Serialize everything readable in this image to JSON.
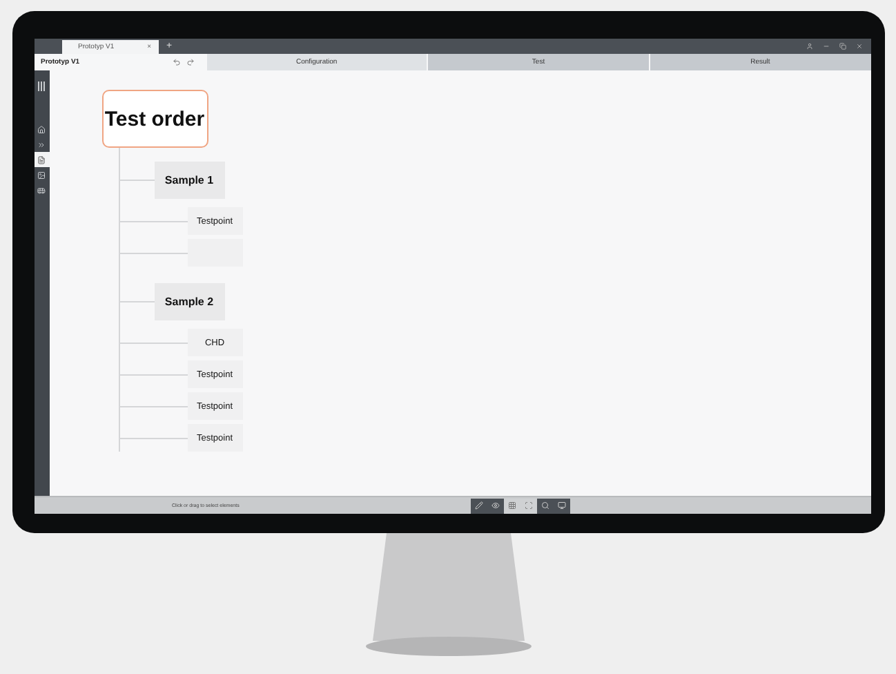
{
  "window": {
    "tab": {
      "title": "Prototyp V1",
      "close": "×"
    },
    "new_tab": "+"
  },
  "project": {
    "name": "Prototyp V1"
  },
  "tabs": [
    {
      "label": "Configuration",
      "selected": true
    },
    {
      "label": "Test",
      "selected": false
    },
    {
      "label": "Result",
      "selected": false
    }
  ],
  "sidebar": {
    "items": [
      {
        "selected": false
      },
      {
        "selected": false
      },
      {
        "selected": true
      },
      {
        "selected": false
      },
      {
        "selected": false
      }
    ]
  },
  "tree": {
    "label": "Test order",
    "children": [
      {
        "kind": "group",
        "label": "Sample 1",
        "children": [
          {
            "kind": "point",
            "label": "Testpoint"
          },
          {
            "kind": "blank"
          }
        ]
      },
      {
        "kind": "group",
        "label": "Sample 2",
        "children": [
          {
            "kind": "point",
            "label": "CHD"
          },
          {
            "kind": "point",
            "label": "Testpoint"
          },
          {
            "kind": "point",
            "label": "Testpoint"
          },
          {
            "kind": "point",
            "label": "Testpoint"
          }
        ]
      }
    ]
  },
  "status_bar": {
    "hint": "Click or drag to select elements",
    "tools": [
      {
        "selected": false
      },
      {
        "selected": false
      },
      {
        "selected": true
      },
      {
        "selected": true
      },
      {
        "selected": false
      },
      {
        "selected": false
      }
    ]
  }
}
